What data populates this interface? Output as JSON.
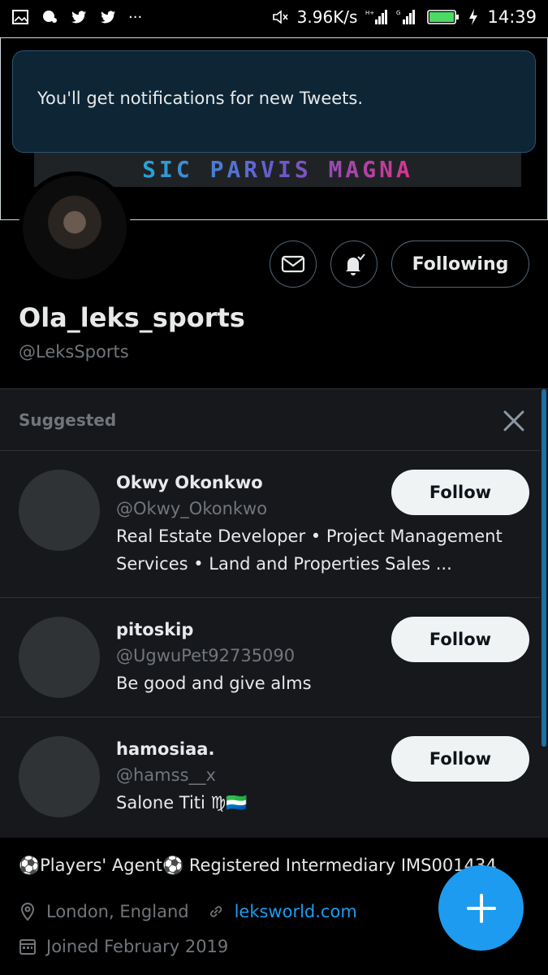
{
  "status_bar": {
    "network_speed": "3.96K/s",
    "time": "14:39",
    "icons": [
      "gallery-icon",
      "chat-icon",
      "twitter-icon",
      "twitter-icon",
      "more-icon",
      "mute-icon",
      "signal-icon",
      "signal-icon",
      "battery-icon",
      "charging-icon"
    ]
  },
  "toast": {
    "message": "You'll get notifications for new Tweets."
  },
  "banner": {
    "text": "SIC PARVIS MAGNA"
  },
  "profile_actions": {
    "message_icon": "mail-icon",
    "notify_icon": "bell-check-icon",
    "following_label": "Following"
  },
  "profile": {
    "display_name": "Ola_leks_sports",
    "handle": "@LeksSports",
    "bio": "⚽Players' Agent⚽ Registered Intermediary IMS001434",
    "location": "London, England",
    "website": "leksworld.com",
    "joined": "Joined February 2019"
  },
  "suggested": {
    "title": "Suggested",
    "close_icon": "close-icon",
    "follow_label": "Follow",
    "users": [
      {
        "name": "Okwy Okonkwo",
        "handle": "@Okwy_Okonkwo",
        "bio_line1": "Real Estate Developer • Project Management",
        "bio_line2": "Services • Land and Properties Sales ..."
      },
      {
        "name": "pitoskip",
        "handle": "@UgwuPet92735090",
        "bio_line1": "Be good and give alms"
      },
      {
        "name": "hamosiaa.",
        "handle": "@hamss__x",
        "bio_line1": "Salone Titi ♍🇸🇱"
      }
    ]
  },
  "fab": {
    "icon": "compose-plus-icon"
  },
  "colors": {
    "accent": "#1d9bf0",
    "background": "#000000",
    "panel": "#16181c",
    "muted_text": "#71767b"
  }
}
